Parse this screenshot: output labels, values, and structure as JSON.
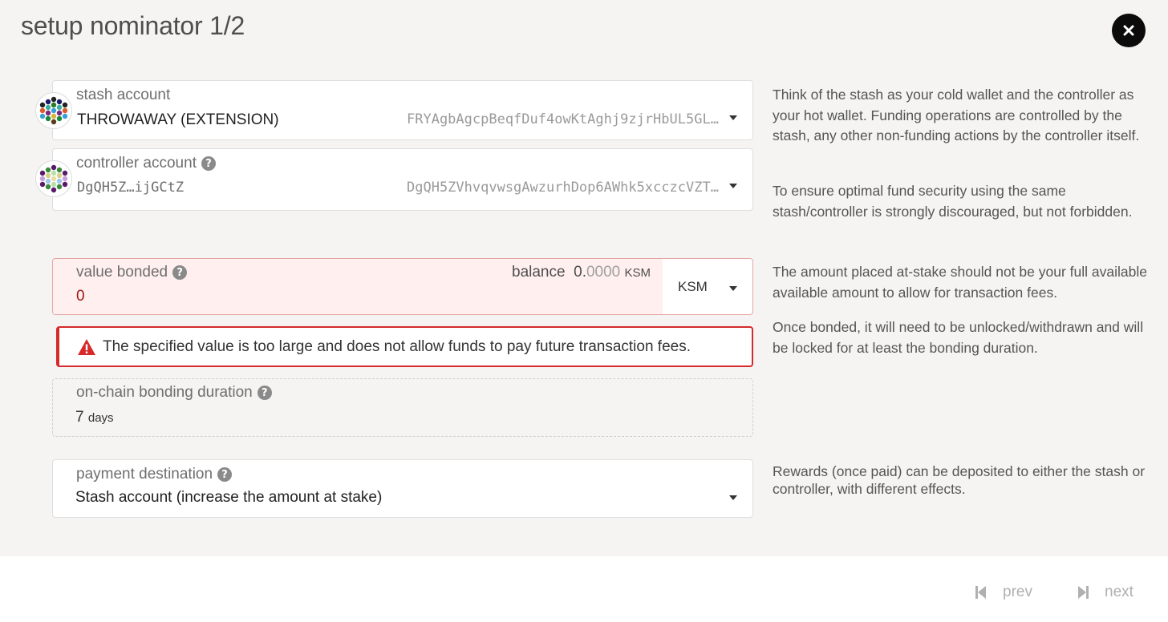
{
  "modal": {
    "title": "setup nominator 1/2"
  },
  "stash": {
    "label": "stash account",
    "name": "THROWAWAY (EXTENSION)",
    "address": "FRYAgbAgcpBeqfDuf4owKtAghj9zjrHbUL5GL…"
  },
  "controller": {
    "label": "controller account",
    "name": "DgQH5Z…ijGCtZ",
    "address": "DgQH5ZVhvqvwsgAwzurhDop6AWhk5xcczcVZT…"
  },
  "bonded": {
    "label": "value bonded",
    "value": "0",
    "balance_label": "balance",
    "balance_int": "0.",
    "balance_dec": "0000",
    "balance_unit": "KSM",
    "unit": "KSM"
  },
  "error": {
    "message": "The specified value is too large and does not allow funds to pay future transaction fees."
  },
  "duration": {
    "label": "on-chain bonding duration",
    "value": "7",
    "unit": "days"
  },
  "payment": {
    "label": "payment destination",
    "value": "Stash account (increase the amount at stake)"
  },
  "help": {
    "stash_1": "Think of the stash as your cold wallet and the controller as your hot wallet. Funding operations are controlled by the stash, any other non-funding actions by the controller itself.",
    "stash_2": "To ensure optimal fund security using the same stash/controller is strongly discouraged, but not forbidden.",
    "bond_1": "The amount placed at-stake should not be your full available available amount to allow for transaction fees.",
    "bond_2": "Once bonded, it will need to be unlocked/withdrawn and will be locked for at least the bonding duration.",
    "payment": "Rewards (once paid) can be deposited to either the stash or controller, with different effects."
  },
  "footer": {
    "prev": "prev",
    "next": "next"
  },
  "colors": {
    "error": "#d62a2a",
    "error_bg": "#fff0ef",
    "close_bg": "#0b0b0b",
    "disabled": "#b0b0b0"
  },
  "icons": [
    "close-icon",
    "identicon",
    "help-icon",
    "caret-down-icon",
    "warning-icon",
    "skip-back-icon",
    "skip-forward-icon"
  ]
}
